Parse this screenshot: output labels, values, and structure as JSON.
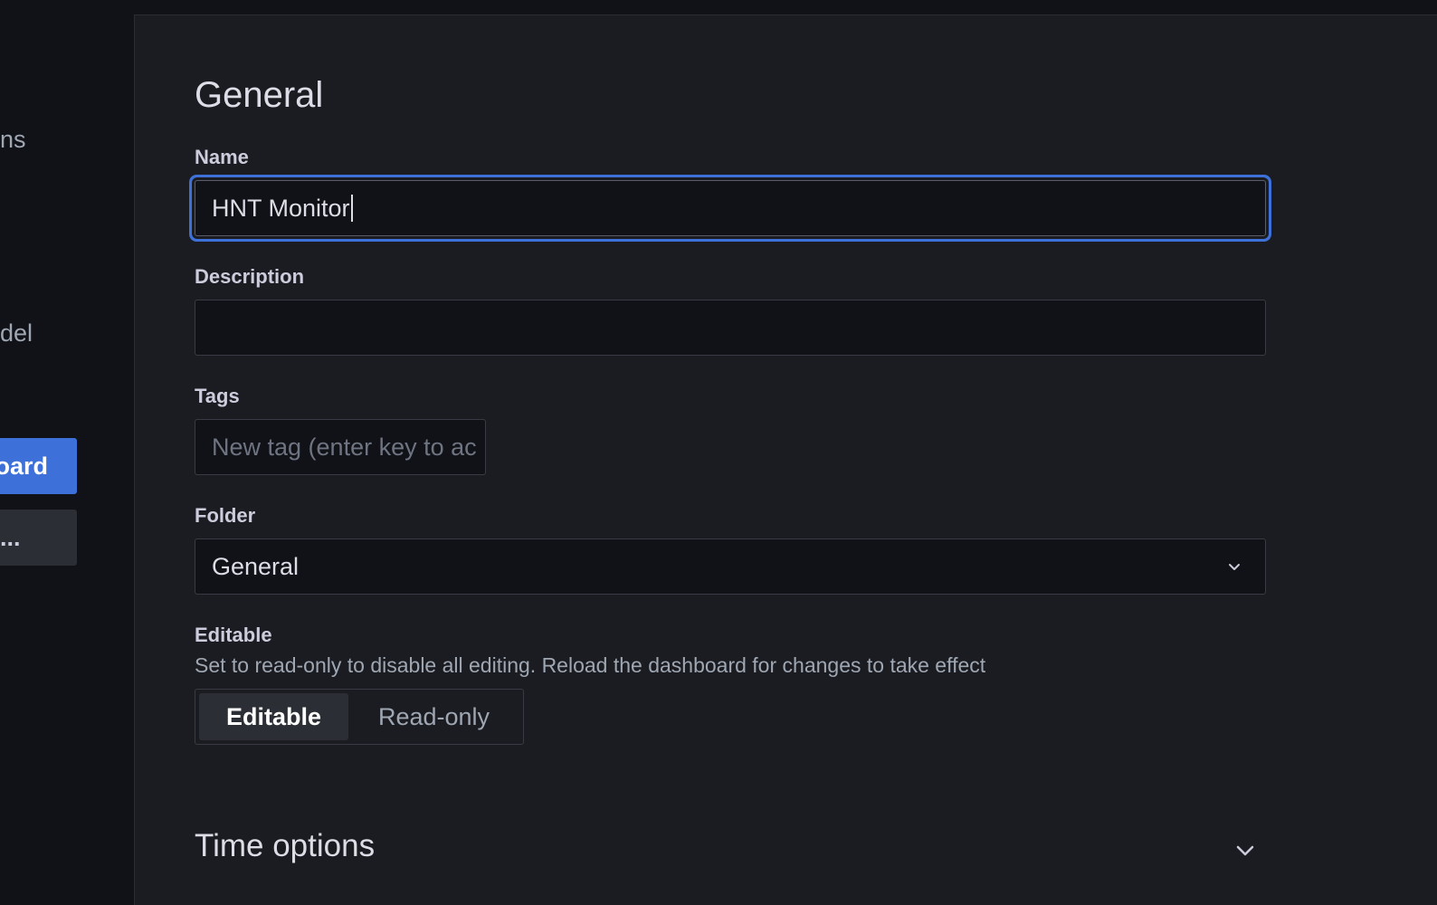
{
  "sidebar": {
    "links": [
      "ns",
      "del"
    ],
    "primary_button": "oard",
    "secondary_button": "..."
  },
  "general": {
    "heading": "General",
    "name_label": "Name",
    "name_value": "HNT Monitor",
    "description_label": "Description",
    "description_value": "",
    "tags_label": "Tags",
    "tags_placeholder": "New tag (enter key to ac",
    "folder_label": "Folder",
    "folder_value": "General",
    "editable_label": "Editable",
    "editable_help": "Set to read-only to disable all editing. Reload the dashboard for changes to take effect",
    "editable_options": [
      "Editable",
      "Read-only"
    ],
    "editable_selected": "Editable"
  },
  "time_options": {
    "heading": "Time options"
  },
  "colors": {
    "accent": "#3d71d9",
    "background": "#1b1c21",
    "input_background": "#111217"
  },
  "icons": {
    "folder_select": "chevron-down-icon",
    "time_options_toggle": "chevron-down-icon"
  }
}
